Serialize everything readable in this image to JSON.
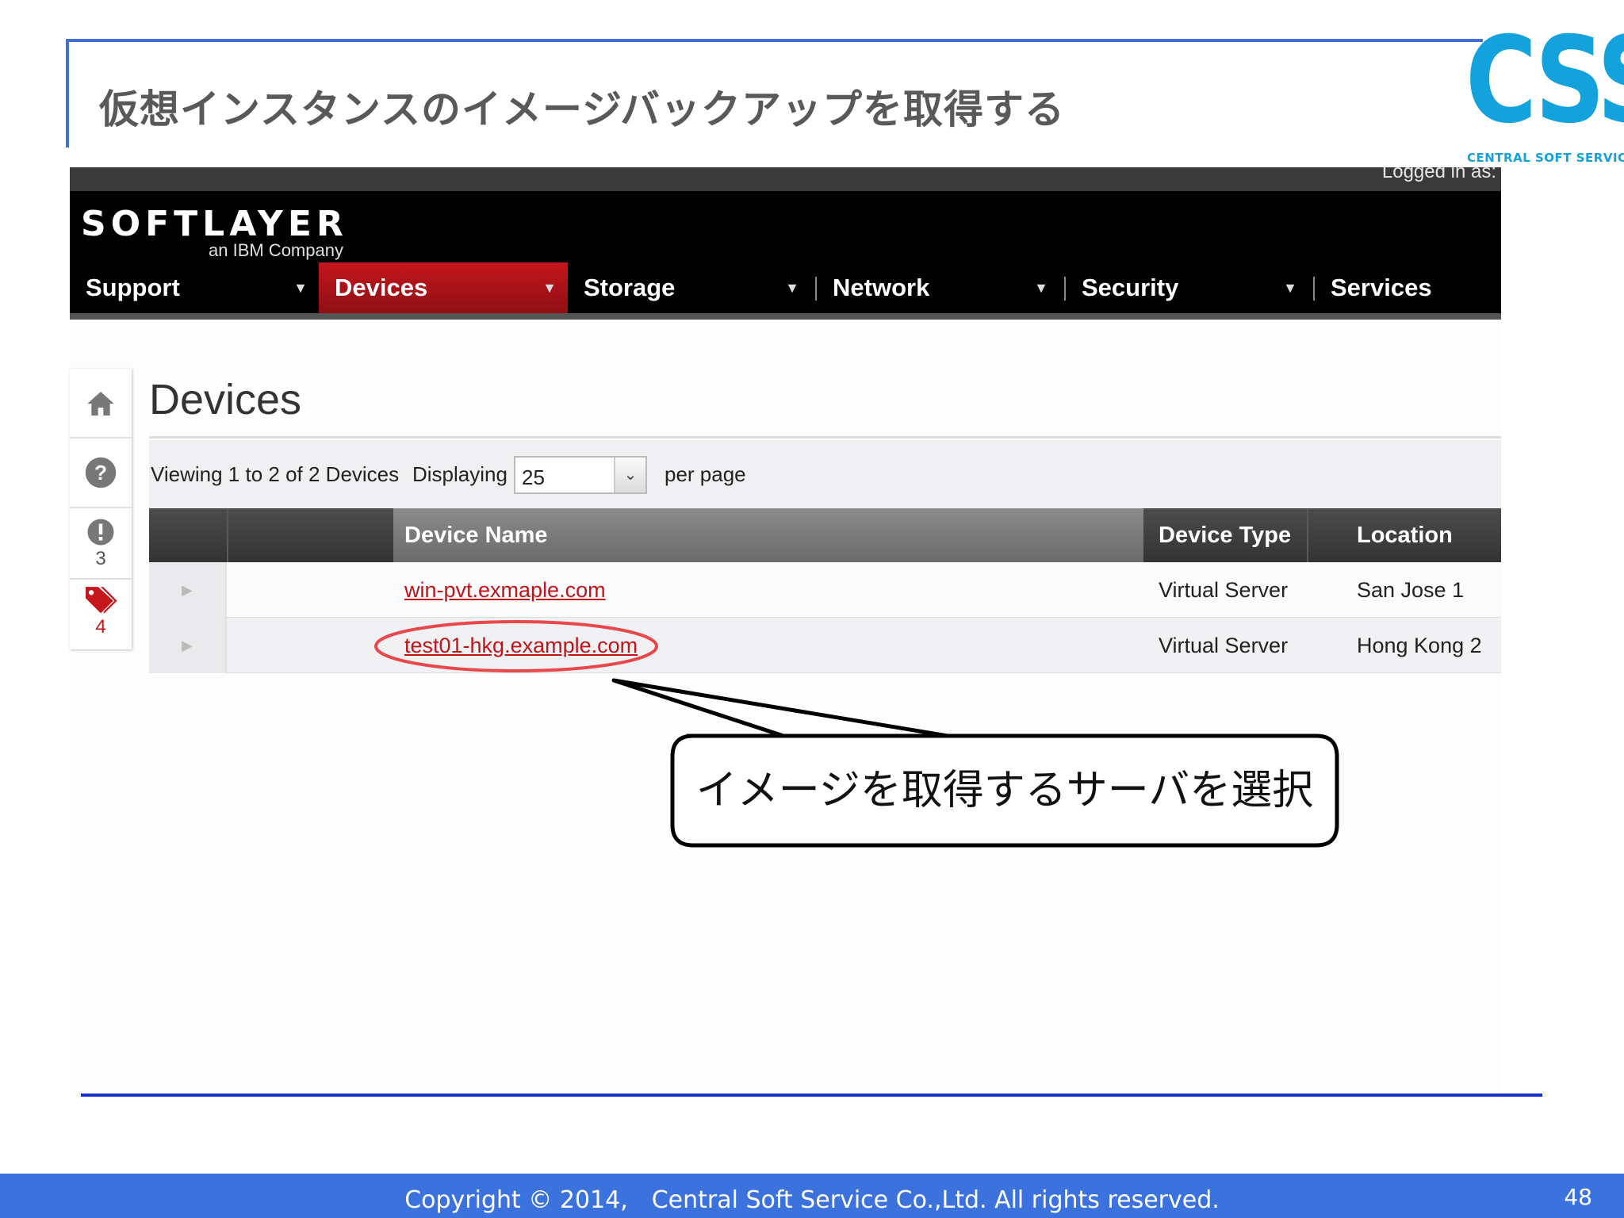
{
  "slide": {
    "title": "仮想インスタンスのイメージバックアップを取得する",
    "logo_text": "CSS",
    "logo_subtitle": "CENTRAL SOFT SERVICE",
    "copyright": "Copyright © 2014,　Central Soft Service Co.,Ltd. All rights reserved.",
    "page_number": "48",
    "callout": "イメージを取得するサーバを選択",
    "colors": {
      "accent_blue": "#3c72dd",
      "logo_blue": "#14a2dd",
      "highlight_red": "#e8474c"
    }
  },
  "app": {
    "logged_in_label": "Logged in as:",
    "brand": "SOFTLAYER",
    "brand_sub": "an IBM Company",
    "nav": [
      {
        "label": "Support",
        "active": false
      },
      {
        "label": "Devices",
        "active": true
      },
      {
        "label": "Storage",
        "active": false
      },
      {
        "label": "Network",
        "active": false
      },
      {
        "label": "Security",
        "active": false
      },
      {
        "label": "Services",
        "active": false
      }
    ],
    "rail": {
      "home_icon": "home-icon",
      "help_icon": "help-icon",
      "alerts_icon": "alert-icon",
      "alerts_count": "3",
      "tags_icon": "tags-icon",
      "tags_count": "4"
    },
    "page_title": "Devices",
    "toolbar": {
      "viewing": "Viewing 1 to 2 of 2 Devices",
      "displaying": "Displaying",
      "per_page_value": "25",
      "per_page": "per page"
    },
    "table": {
      "headers": {
        "name": "Device Name",
        "type": "Device Type",
        "location": "Location"
      },
      "rows": [
        {
          "name": "win-pvt.exmaple.com",
          "type": "Virtual Server",
          "location": "San Jose 1"
        },
        {
          "name": "test01-hkg.example.com",
          "type": "Virtual Server",
          "location": "Hong Kong 2"
        }
      ]
    }
  }
}
